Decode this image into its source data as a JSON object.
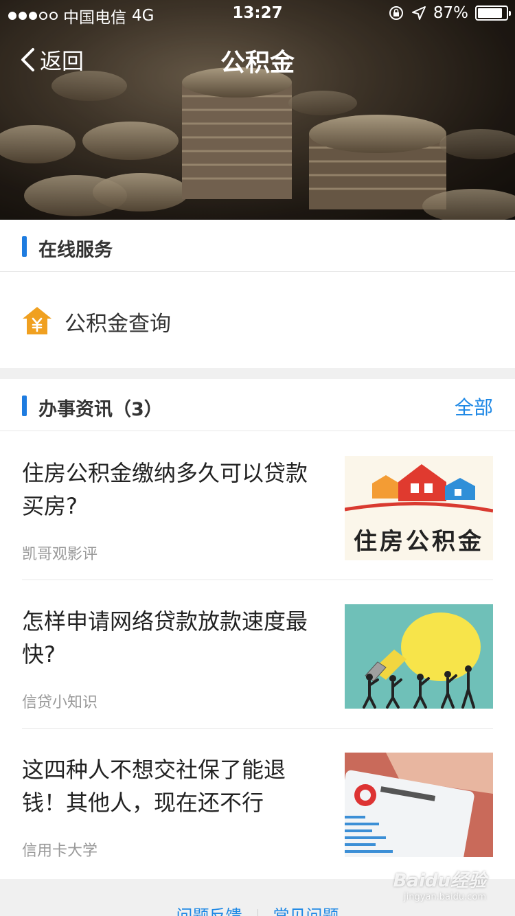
{
  "status_bar": {
    "carrier": "中国电信",
    "network": "4G",
    "time": "13:27",
    "battery": "87%",
    "battery_level": 0.87,
    "signal_bars_filled": 3,
    "signal_bars_total": 5
  },
  "nav": {
    "back_label": "返回",
    "title": "公积金"
  },
  "online_service": {
    "title": "在线服务",
    "items": [
      {
        "label": "公积金查询",
        "icon": "yuan-house-icon"
      }
    ]
  },
  "news": {
    "title": "办事资讯（3）",
    "more_label": "全部",
    "items": [
      {
        "title": "住房公积金缴纳多久可以贷款买房?",
        "source": "凯哥观影评",
        "thumb_text": "住房公积金"
      },
      {
        "title": "怎样申请网络贷款放款速度最快?",
        "source": "信贷小知识"
      },
      {
        "title": "这四种人不想交社保了能退钱！其他人，现在还不行",
        "source": "信用卡大学"
      }
    ]
  },
  "footer": {
    "feedback_label": "问题反馈",
    "faq_label": "常见问题"
  },
  "watermark": {
    "brand": "Baidu经验",
    "url": "jingyan.baidu.com"
  },
  "colors": {
    "accent": "#1e7ce0",
    "link": "#1e88e5",
    "icon_orange": "#f0a020"
  }
}
